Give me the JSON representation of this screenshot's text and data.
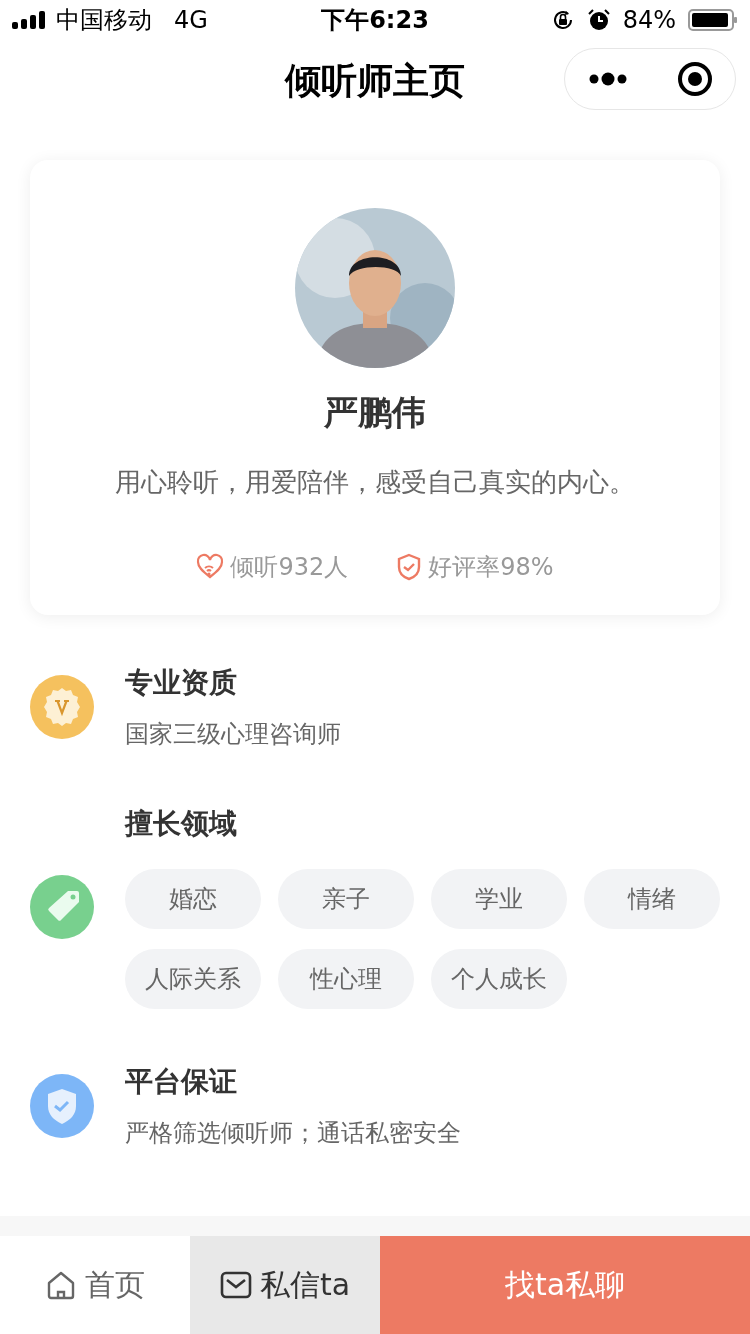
{
  "status_bar": {
    "carrier": "中国移动",
    "network": "4G",
    "time": "下午6:23",
    "battery": "84%"
  },
  "nav": {
    "title": "倾听师主页"
  },
  "profile": {
    "name": "严鹏伟",
    "motto": "用心聆听，用爱陪伴，感受自己真实的内心。",
    "stats": [
      {
        "kind": "listens",
        "text": "倾听932人"
      },
      {
        "kind": "rating",
        "text": "好评率98%"
      }
    ]
  },
  "sections": [
    {
      "kind": "qualification",
      "title": "专业资质",
      "text": "国家三级心理咨询师"
    },
    {
      "kind": "expertise",
      "title": "擅长领域",
      "tags": [
        "婚恋",
        "亲子",
        "学业",
        "情绪",
        "人际关系",
        "性心理",
        "个人成长"
      ]
    },
    {
      "kind": "guarantee",
      "title": "平台保证",
      "text": "严格筛选倾听师；通话私密安全"
    }
  ],
  "bottom_bar": {
    "home": "首页",
    "message": "私信ta",
    "chat": "找ta私聊"
  }
}
